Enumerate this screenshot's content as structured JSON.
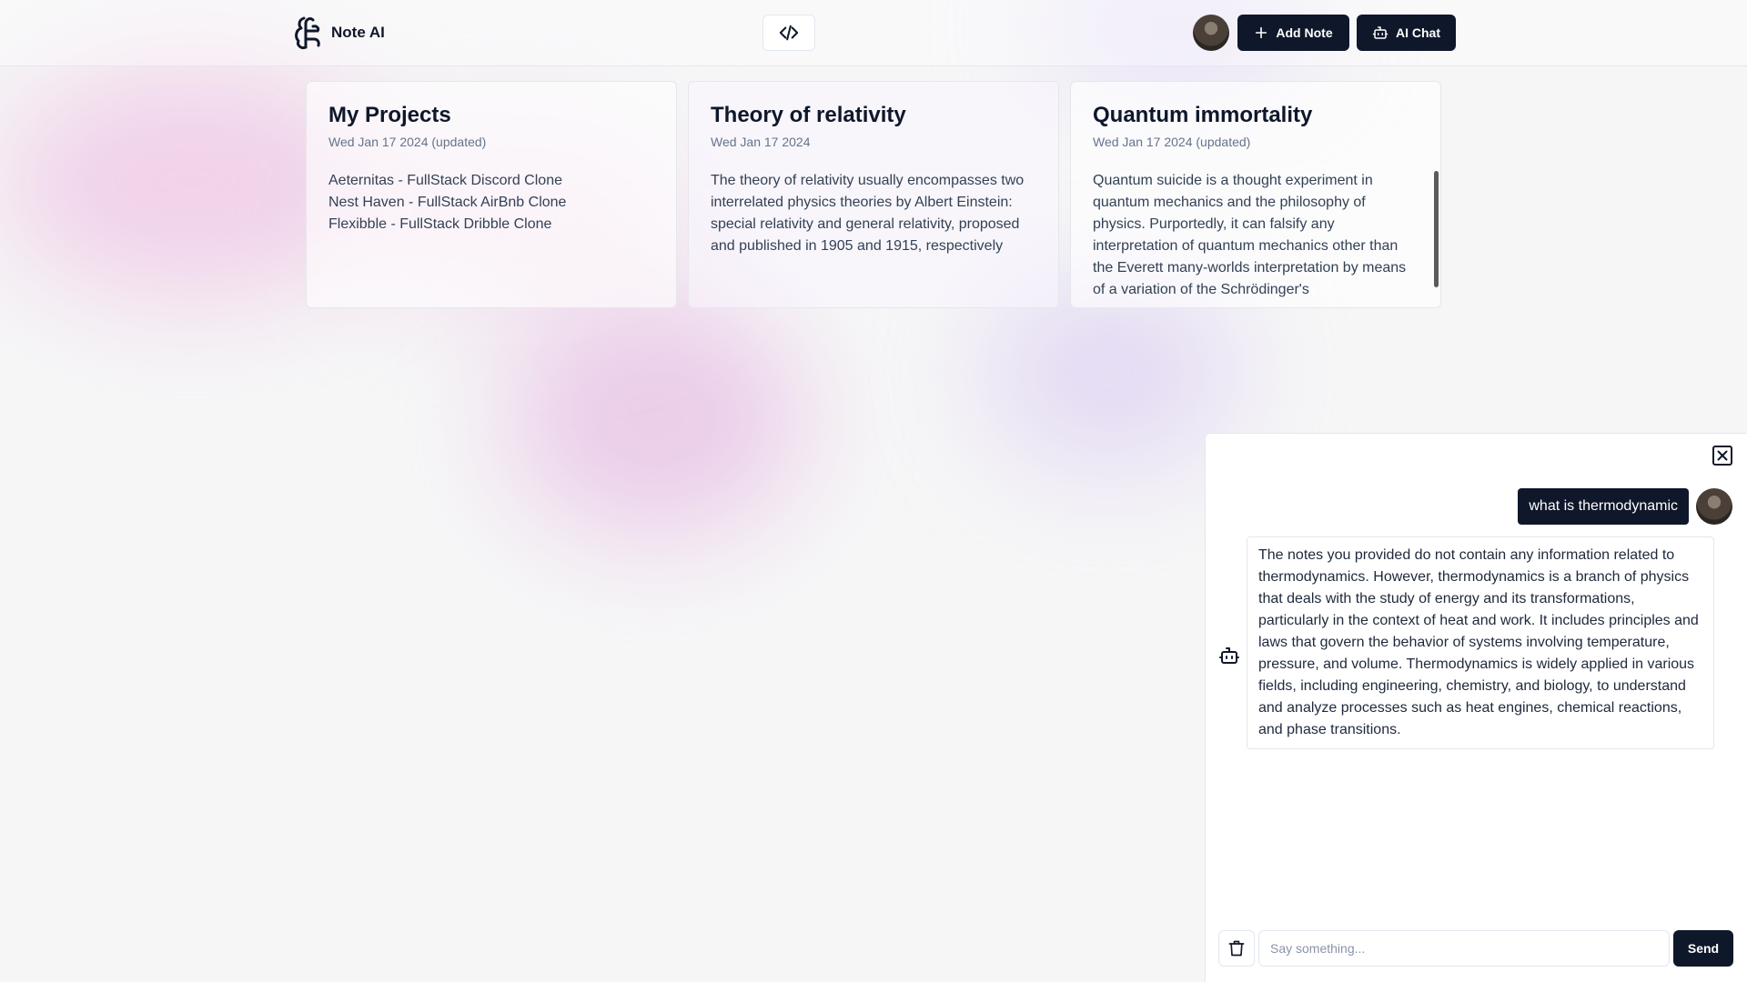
{
  "header": {
    "brand_name": "Note AI",
    "add_note_label": "Add Note",
    "ai_chat_label": "AI Chat"
  },
  "notes": [
    {
      "title": "My Projects",
      "date": "Wed Jan 17 2024 (updated)",
      "body": "Aeternitas - FullStack Discord Clone\nNest Haven - FullStack AirBnb Clone\nFlexibble - FullStack Dribble Clone"
    },
    {
      "title": "Theory of relativity",
      "date": "Wed Jan 17 2024",
      "body": "The theory of relativity usually encompasses two interrelated physics theories by Albert Einstein: special relativity and general relativity, proposed and published in 1905 and 1915, respectively"
    },
    {
      "title": "Quantum immortality",
      "date": "Wed Jan 17 2024 (updated)",
      "body": "Quantum suicide is a thought experiment in quantum mechanics and the philosophy of physics. Purportedly, it can falsify any interpretation of quantum mechanics other than the Everett many-worlds interpretation by means of a variation of the Schrödinger's"
    }
  ],
  "chat": {
    "user_message": "what is thermodynamic",
    "assistant_message": "The notes you provided do not contain any information related to thermodynamics. However, thermodynamics is a branch of physics that deals with the study of energy and its transformations, particularly in the context of heat and work. It includes principles and laws that govern the behavior of systems involving temperature, pressure, and volume. Thermodynamics is widely applied in various fields, including engineering, chemistry, and biology, to understand and analyze processes such as heat engines, chemical reactions, and phase transitions.",
    "input_placeholder": "Say something...",
    "input_value": "",
    "send_label": "Send"
  },
  "icons": {
    "brand": "brain-logo-icon",
    "code": "code-icon",
    "add": "plus-icon",
    "ai_chat": "bot-icon",
    "close": "close-icon",
    "trash": "trash-icon"
  },
  "colors": {
    "primary": "#0f172a",
    "muted_text": "#64748b",
    "border": "#e5e7eb"
  }
}
